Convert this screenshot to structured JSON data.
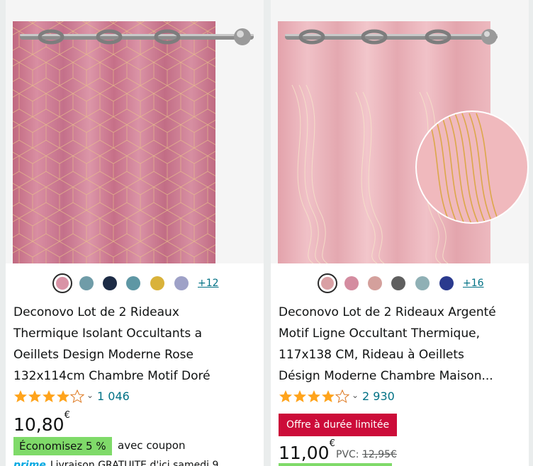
{
  "products": [
    {
      "swatch_colors": [
        "#d993a6",
        "#6f9ca8",
        "#1c2b45",
        "#5e97a4",
        "#d9b23a",
        "#9ea1c7"
      ],
      "more_colors_label": "+12",
      "title_lines": [
        "Deconovo Lot de 2 Rideaux",
        "Thermique Isolant Occultants a",
        "Oeillets Design Moderne Rose",
        "132x114cm Chambre Motif Doré"
      ],
      "rating": 4.5,
      "review_count": "1 046",
      "price_whole": "10,80",
      "currency": "€",
      "save_label": "Économisez 5 %",
      "coupon_label": "avec coupon",
      "prime_label": "prime",
      "delivery_text": "Livraison GRATUITE d'ici samedi 9"
    },
    {
      "swatch_colors": [
        "#d9a0a4",
        "#d48ca0",
        "#d4a09c",
        "#5f5f5f",
        "#8fb0b5",
        "#2a3a8e"
      ],
      "more_colors_label": "+16",
      "title_lines": [
        "Deconovo Lot de 2 Rideaux Argenté",
        "Motif Ligne Occultant Thermique,",
        "117x138 CM, Rideau à Oeillets",
        "Désign Moderne Chambre Maison..."
      ],
      "rating": 4.5,
      "review_count": "2 930",
      "deal_label": "Offre à durée limitée",
      "price_whole": "11,00",
      "currency": "€",
      "pvc_label": "PVC:",
      "old_price": "12,95€"
    }
  ],
  "colors": {
    "link": "#007185",
    "star": "#ffa41c",
    "deal_red": "#cc0c39",
    "save_green": "#7fda69",
    "curtain1": "#c9788f",
    "curtain2": "#eab1b8"
  }
}
